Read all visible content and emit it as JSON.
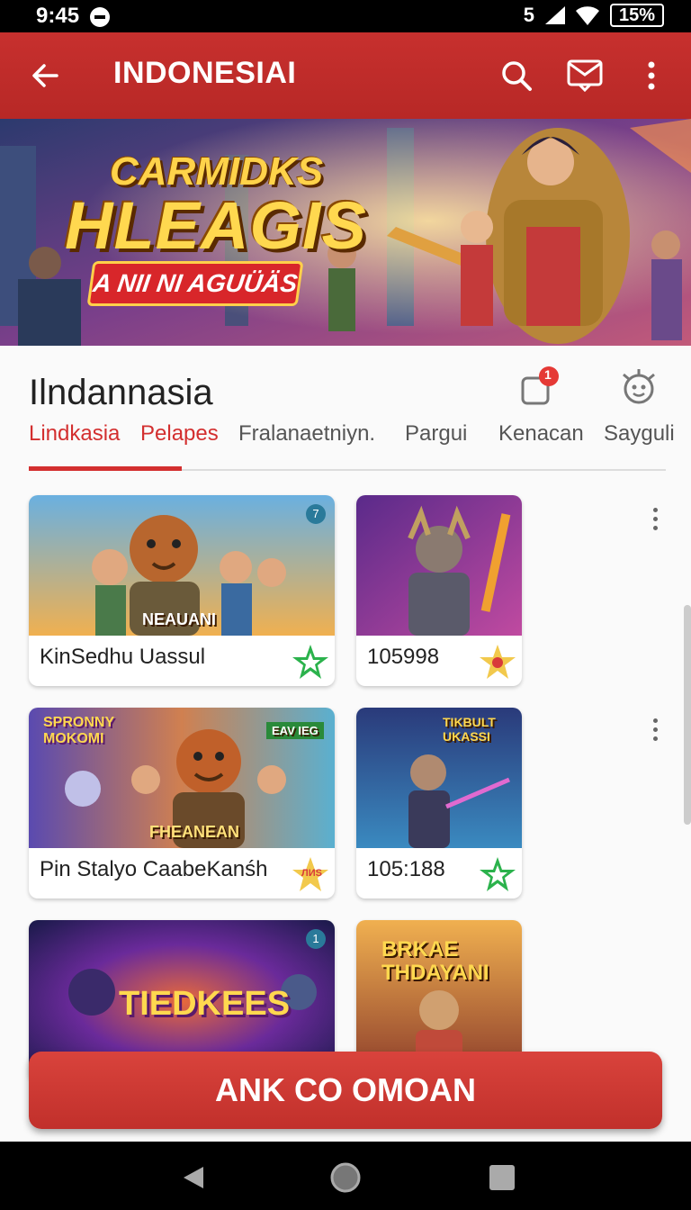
{
  "status": {
    "time": "9:45",
    "signal": "5",
    "battery": "15%"
  },
  "appbar": {
    "title": "INDONESIAI",
    "back_icon": "arrow-back-icon",
    "search_icon": "search-icon",
    "mail_icon": "mail-icon",
    "menu_icon": "more-vert-icon"
  },
  "banner": {
    "line1": "CARMIDKS",
    "line2": "HLEAGIS",
    "subtitle": "A NII NI AGUÜÄS"
  },
  "section": {
    "title": "Ilndannasia",
    "notif_count": "1"
  },
  "tabs": [
    "Lindkasia",
    "Pelapes",
    "Fralanaetniyn.",
    "Pargui",
    "Kenacan",
    "Sayguli"
  ],
  "cards": [
    {
      "label": "KinSedhu Uassul",
      "image_text": "NEAUANI",
      "badge": "7"
    },
    {
      "label": "105998"
    },
    {
      "label": "Pin Stalyo CaabeKanśh",
      "image_text": "FHEANEAN",
      "image_text_2": "SPRONNY MOKOMI",
      "image_text_3": "EAV IEG",
      "star_text": "ЛИЅ"
    },
    {
      "label": "105:188",
      "image_text": "TIKBULT UKASSI"
    },
    {
      "image_text": "TIEDKEES",
      "badge": "1"
    },
    {
      "image_text": "BRKAE THDAYANI"
    }
  ],
  "cta": {
    "label": "ANK CO OMOAN"
  },
  "colors": {
    "primary": "#c62f2d",
    "accent_green": "#2bb24c",
    "star_gold": "#f2c94c"
  }
}
